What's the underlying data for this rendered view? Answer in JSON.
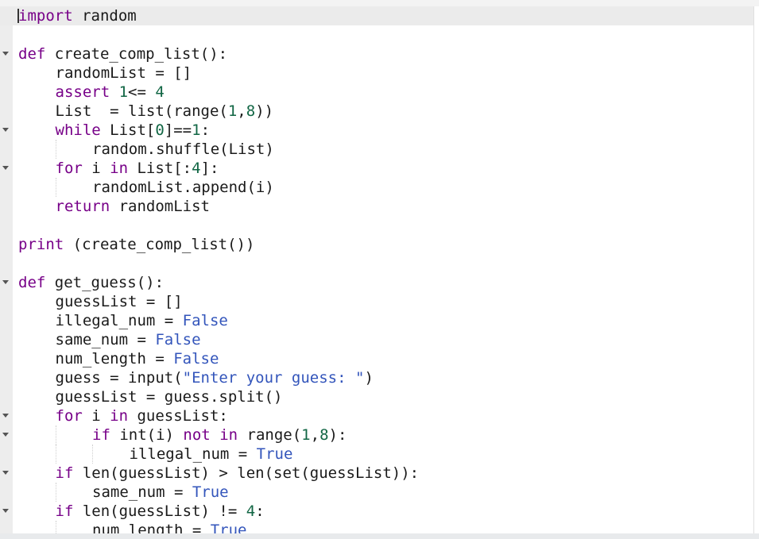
{
  "editor": {
    "language": "python",
    "colors": {
      "keyword": "#770088",
      "number": "#116644",
      "literal": "#3355bb",
      "text": "#1a1a1a",
      "active_line_bg": "#ebebeb"
    },
    "lines": [
      {
        "indent": 0,
        "fold": false,
        "active": true,
        "tokens": [
          [
            "kw",
            "import"
          ],
          [
            "t",
            " random"
          ]
        ]
      },
      {
        "indent": 0,
        "fold": false,
        "tokens": []
      },
      {
        "indent": 0,
        "fold": true,
        "tokens": [
          [
            "kw",
            "def"
          ],
          [
            "t",
            " create_comp_list():"
          ]
        ]
      },
      {
        "indent": 1,
        "fold": false,
        "tokens": [
          [
            "t",
            "randomList = []"
          ]
        ]
      },
      {
        "indent": 1,
        "fold": false,
        "tokens": [
          [
            "kw",
            "assert"
          ],
          [
            "t",
            " "
          ],
          [
            "num",
            "1"
          ],
          [
            "t",
            "<= "
          ],
          [
            "num",
            "4"
          ]
        ]
      },
      {
        "indent": 1,
        "fold": false,
        "tokens": [
          [
            "t",
            "List  = list(range("
          ],
          [
            "num",
            "1"
          ],
          [
            "t",
            ","
          ],
          [
            "num",
            "8"
          ],
          [
            "t",
            "))"
          ]
        ]
      },
      {
        "indent": 1,
        "fold": true,
        "tokens": [
          [
            "kw",
            "while"
          ],
          [
            "t",
            " List["
          ],
          [
            "num",
            "0"
          ],
          [
            "t",
            "]=="
          ],
          [
            "num",
            "1"
          ],
          [
            "t",
            ":"
          ]
        ]
      },
      {
        "indent": 2,
        "fold": false,
        "tokens": [
          [
            "t",
            "random.shuffle(List)"
          ]
        ]
      },
      {
        "indent": 1,
        "fold": true,
        "tokens": [
          [
            "kw",
            "for"
          ],
          [
            "t",
            " i "
          ],
          [
            "kw",
            "in"
          ],
          [
            "t",
            " List[:"
          ],
          [
            "num",
            "4"
          ],
          [
            "t",
            "]:"
          ]
        ]
      },
      {
        "indent": 2,
        "fold": false,
        "tokens": [
          [
            "t",
            "randomList.append(i)"
          ]
        ]
      },
      {
        "indent": 1,
        "fold": false,
        "tokens": [
          [
            "kw",
            "return"
          ],
          [
            "t",
            " randomList"
          ]
        ]
      },
      {
        "indent": 0,
        "fold": false,
        "tokens": []
      },
      {
        "indent": 0,
        "fold": false,
        "tokens": [
          [
            "kw",
            "print"
          ],
          [
            "t",
            " (create_comp_list())"
          ]
        ]
      },
      {
        "indent": 0,
        "fold": false,
        "tokens": []
      },
      {
        "indent": 0,
        "fold": true,
        "tokens": [
          [
            "kw",
            "def"
          ],
          [
            "t",
            " get_guess():"
          ]
        ]
      },
      {
        "indent": 1,
        "fold": false,
        "tokens": [
          [
            "t",
            "guessList = []"
          ]
        ]
      },
      {
        "indent": 1,
        "fold": false,
        "tokens": [
          [
            "t",
            "illegal_num = "
          ],
          [
            "bool",
            "False"
          ]
        ]
      },
      {
        "indent": 1,
        "fold": false,
        "tokens": [
          [
            "t",
            "same_num = "
          ],
          [
            "bool",
            "False"
          ]
        ]
      },
      {
        "indent": 1,
        "fold": false,
        "tokens": [
          [
            "t",
            "num_length = "
          ],
          [
            "bool",
            "False"
          ]
        ]
      },
      {
        "indent": 1,
        "fold": false,
        "tokens": [
          [
            "t",
            "guess = input("
          ],
          [
            "str",
            "\"Enter your guess: \""
          ],
          [
            "t",
            ")"
          ]
        ]
      },
      {
        "indent": 1,
        "fold": false,
        "tokens": [
          [
            "t",
            "guessList = guess.split()"
          ]
        ]
      },
      {
        "indent": 1,
        "fold": true,
        "tokens": [
          [
            "kw",
            "for"
          ],
          [
            "t",
            " i "
          ],
          [
            "kw",
            "in"
          ],
          [
            "t",
            " guessList:"
          ]
        ]
      },
      {
        "indent": 2,
        "fold": true,
        "tokens": [
          [
            "kw",
            "if"
          ],
          [
            "t",
            " int(i) "
          ],
          [
            "kw",
            "not"
          ],
          [
            "t",
            " "
          ],
          [
            "kw",
            "in"
          ],
          [
            "t",
            " range("
          ],
          [
            "num",
            "1"
          ],
          [
            "t",
            ","
          ],
          [
            "num",
            "8"
          ],
          [
            "t",
            "):"
          ]
        ]
      },
      {
        "indent": 3,
        "fold": false,
        "tokens": [
          [
            "t",
            "illegal_num = "
          ],
          [
            "bool",
            "True"
          ]
        ]
      },
      {
        "indent": 1,
        "fold": true,
        "tokens": [
          [
            "kw",
            "if"
          ],
          [
            "t",
            " len(guessList) > len(set(guessList)):"
          ]
        ]
      },
      {
        "indent": 2,
        "fold": false,
        "tokens": [
          [
            "t",
            "same_num = "
          ],
          [
            "bool",
            "True"
          ]
        ]
      },
      {
        "indent": 1,
        "fold": true,
        "tokens": [
          [
            "kw",
            "if"
          ],
          [
            "t",
            " len(guessList) != "
          ],
          [
            "num",
            "4"
          ],
          [
            "t",
            ":"
          ]
        ]
      },
      {
        "indent": 2,
        "fold": false,
        "tokens": [
          [
            "t",
            "num_length = "
          ],
          [
            "bool",
            "True"
          ]
        ]
      }
    ]
  }
}
